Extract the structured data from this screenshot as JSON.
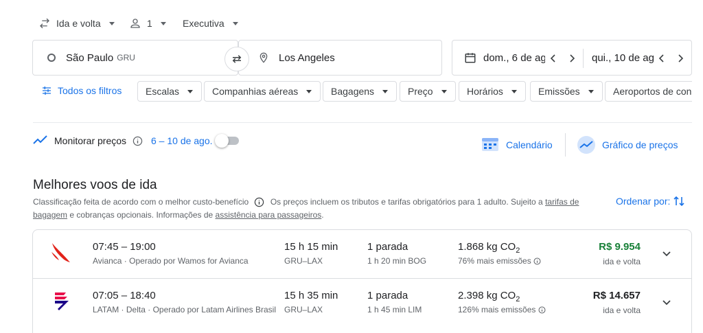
{
  "search_options": {
    "trip_type": "Ida e volta",
    "passengers": "1",
    "cabin_class": "Executiva"
  },
  "search_form": {
    "origin_city": "São Paulo",
    "origin_code": "GRU",
    "destination": "Los Angeles",
    "depart_date": "dom., 6 de ag",
    "return_date": "qui., 10 de ag"
  },
  "filters": {
    "all_filters": "Todos os filtros",
    "chips": [
      "Escalas",
      "Companhias aéreas",
      "Bagagens",
      "Preço",
      "Horários",
      "Emissões",
      "Aeroportos de con"
    ]
  },
  "tracking": {
    "label": "Monitorar preços",
    "dates": "6 – 10 de ago.",
    "calendar": "Calendário",
    "price_graph": "Gráfico de preços"
  },
  "results": {
    "title": "Melhores voos de ida",
    "ranking_note": "Classificação feita de acordo com o melhor custo-benefício",
    "prices_note": "Os preços incluem os tributos e tarifas obrigatórios para 1 adulto. Sujeito a",
    "baggage_link_1": "tarifas de",
    "baggage_link_2": "bagagem",
    "optional_note": "e cobranças opcionais. Informações de",
    "assistance_link": "assistência para passageiros",
    "period": ".",
    "sort_label": "Ordenar por:",
    "flights": [
      {
        "times": "07:45 – 19:00",
        "airline": "Avianca · Operado por Wamos for Avianca",
        "duration": "15 h 15 min",
        "route": "GRU–LAX",
        "stops": "1 parada",
        "layover": "1 h 20 min BOG",
        "emissions_value": "1.868 kg CO",
        "emissions_sub": "2",
        "emissions_note": "76% mais emissões",
        "price": "R$ 9.954",
        "price_type": "ida e volta",
        "price_color": "#188038"
      },
      {
        "times": "07:05 – 18:40",
        "airline": "LATAM · Delta · Operado por Latam Airlines Brasil",
        "duration": "15 h 35 min",
        "route": "GRU–LAX",
        "stops": "1 parada",
        "layover": "1 h 45 min LIM",
        "emissions_value": "2.398 kg CO",
        "emissions_sub": "2",
        "emissions_note": "126% mais emissões",
        "price": "R$ 14.657",
        "price_type": "ida e volta",
        "price_color": "#202124"
      }
    ]
  }
}
